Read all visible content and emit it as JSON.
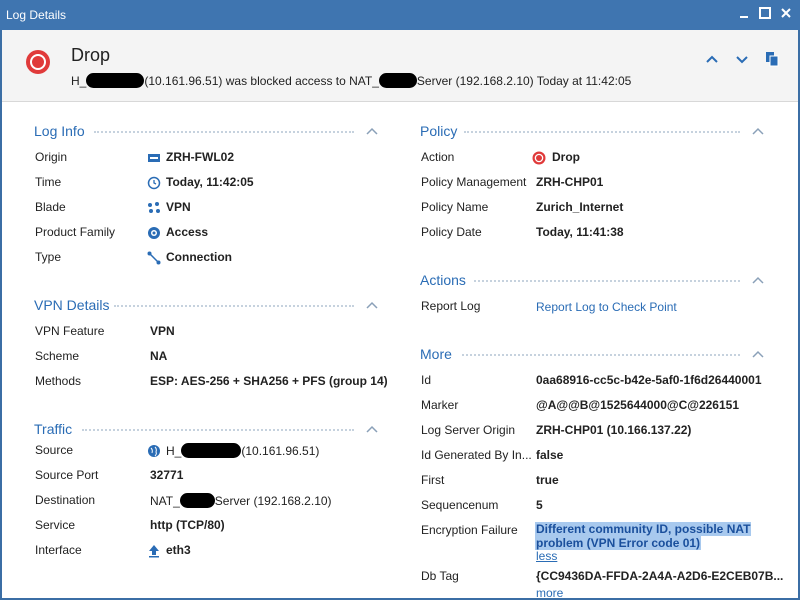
{
  "window": {
    "title": "Log Details",
    "controls": [
      "minimize",
      "maximize",
      "close"
    ]
  },
  "header": {
    "action": "Drop",
    "desc_prefix": "H_",
    "desc_mid1": "(10.161.96.51) was blocked access to NAT_",
    "desc_mid2": "Server (192.168.2.10) Today at  11:42:05",
    "accent": "#e03a3a"
  },
  "log_info": {
    "title": "Log Info",
    "rows": [
      {
        "label": "Origin",
        "value": "ZRH-FWL02",
        "icon": "gateway-icon"
      },
      {
        "label": "Time",
        "value": "Today, 11:42:05",
        "icon": "clock-icon"
      },
      {
        "label": "Blade",
        "value": "VPN",
        "icon": "vpn-icon"
      },
      {
        "label": "Product Family",
        "value": "Access",
        "icon": "access-icon"
      },
      {
        "label": "Type",
        "value": "Connection",
        "icon": "connection-icon"
      }
    ]
  },
  "vpn_details": {
    "title": "VPN Details",
    "rows": [
      {
        "label": "VPN Feature",
        "value": "VPN"
      },
      {
        "label": "Scheme",
        "value": "NA"
      },
      {
        "label": "Methods",
        "value": "ESP: AES-256 + SHA256 + PFS (group 14)"
      }
    ]
  },
  "traffic": {
    "title": "Traffic",
    "rows": [
      {
        "label": "Source",
        "value_prefix": "H_",
        "value_suffix": "(10.161.96.51)",
        "icon": "globe-icon"
      },
      {
        "label": "Source Port",
        "value": "32771"
      },
      {
        "label": "Destination",
        "value_prefix": "NAT_",
        "value_suffix": "Server (192.168.2.10)"
      },
      {
        "label": "Service",
        "value": "http (TCP/80)"
      },
      {
        "label": "Interface",
        "value": "eth3",
        "icon": "arrow-up-icon"
      }
    ]
  },
  "policy": {
    "title": "Policy",
    "rows": [
      {
        "label": "Action",
        "value": "Drop",
        "icon": "drop-icon"
      },
      {
        "label": "Policy Management",
        "value": "ZRH-CHP01"
      },
      {
        "label": "Policy Name",
        "value": "Zurich_Internet"
      },
      {
        "label": "Policy Date",
        "value": "Today, 11:41:38"
      }
    ]
  },
  "actions": {
    "title": "Actions",
    "rows": [
      {
        "label": "Report Log",
        "link": "Report Log to Check Point"
      }
    ]
  },
  "more": {
    "title": "More",
    "rows": [
      {
        "label": "Id",
        "value": "0aa68916-cc5c-b42e-5af0-1f6d26440001"
      },
      {
        "label": "Marker",
        "value": "@A@@B@1525644000@C@226151"
      },
      {
        "label": "Log Server Origin",
        "value": "ZRH-CHP01 (10.166.137.22)"
      },
      {
        "label": "Id Generated By In...",
        "value": "false"
      },
      {
        "label": "First",
        "value": "true"
      },
      {
        "label": "Sequencenum",
        "value": "5"
      },
      {
        "label": "Encryption Failure",
        "value_line1": "Different community ID, possible NAT",
        "value_line2": "problem (VPN Error code 01)",
        "less": "less"
      },
      {
        "label": "Db Tag",
        "value": "{CC9436DA-FFDA-2A4A-A2D6-E2CEB07B..."
      }
    ],
    "more_link": "more"
  }
}
